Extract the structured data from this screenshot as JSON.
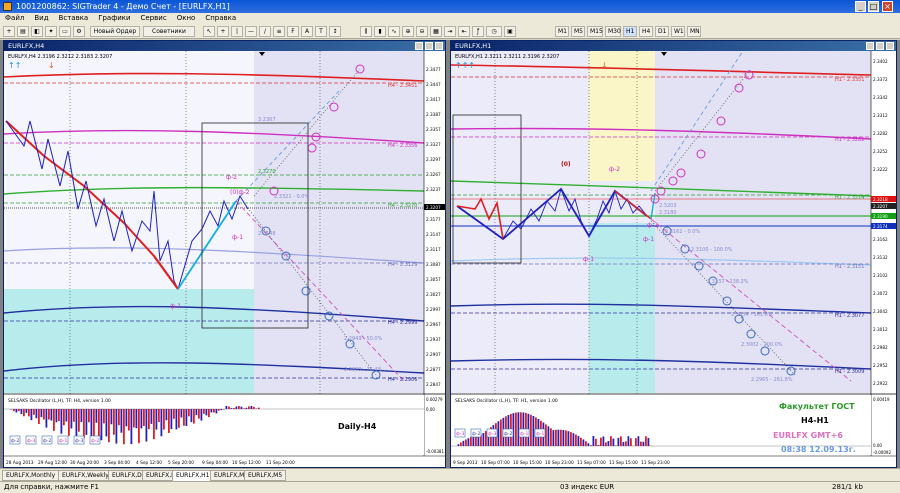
{
  "app": {
    "title": "1001200862: SIGTrader 4 - Демо Счет - [EURLFX,H1]"
  },
  "menu": [
    "Файл",
    "Вид",
    "Вставка",
    "Графики",
    "Сервис",
    "Окно",
    "Справка"
  ],
  "toolbar": {
    "new_order": "Новый Ордер",
    "advisors": "Советники",
    "timeframes": [
      "M1",
      "M5",
      "M15",
      "M30",
      "H1",
      "H4",
      "D1",
      "W1",
      "MN"
    ]
  },
  "left_window": {
    "title": "EURLFX,H4",
    "info": "EURLFX,H4  2.3196 2.3212 2.3183 2.3207",
    "price_ticks": [
      "2.3477",
      "2.3447",
      "2.3417",
      "2.3387",
      "2.3357",
      "2.3327",
      "2.3297",
      "2.3267",
      "2.3237",
      "2.3207",
      "2.3177",
      "2.3147",
      "2.3117",
      "2.3087",
      "2.3057",
      "2.3027",
      "2.2997",
      "2.2967",
      "2.2937",
      "2.2907",
      "2.2877",
      "2.2847"
    ],
    "levels": [
      {
        "label": "H4 - 2.3451",
        "color": "#e03030"
      },
      {
        "label": "H4 - 2.3356",
        "color": "#d030c0"
      },
      {
        "label": "H4 - 2.3270",
        "color": "#30a030"
      },
      {
        "label": "H4 - 2.3129",
        "color": "#7070c0"
      },
      {
        "label": "H4 - 2.2999",
        "color": "#3030a0"
      },
      {
        "label": "H4 - 2.2906",
        "color": "#3030a0"
      }
    ],
    "fibs": [
      "3.2367",
      "2.3321 - 0.0%",
      "2.3270",
      "2.3148",
      "2.2949 - 50.0%",
      "2.2883 - 76.4%"
    ],
    "markers": [
      "ф-2",
      "(0)ф-2",
      "ф-1",
      "ф-1"
    ],
    "dates": [
      "28 Aug 2013",
      "29 Aug 12:00",
      "30 Aug 20:00",
      "3 Sep 04:00",
      "4 Sep 12:00",
      "5 Sep 20:00",
      "9 Sep 04:00",
      "10 Sep 12:00",
      "11 Sep 20:00"
    ],
    "osc_label": "SELSAKS Oscillator (L,H), TF: H4, version 1.00",
    "osc_ticks": [
      "0.00279",
      "0.00",
      "-0.00381"
    ],
    "boxes": [
      "ф-2",
      "ф-3",
      "ф-2",
      "ф-1",
      "ф-3",
      "ф-2"
    ],
    "caption": "Daily-H4"
  },
  "right_window": {
    "title": "EURLFX,H1",
    "info": "EURLFX,H1  2.3211 2.3211 2.3196 2.3207",
    "price_ticks": [
      "2.3402",
      "2.3372",
      "2.3342",
      "2.3312",
      "2.3282",
      "2.3252",
      "2.3222",
      "2.3207",
      "2.3192",
      "2.3174",
      "2.3162",
      "2.3132",
      "2.3102",
      "2.3072",
      "2.3042",
      "2.3012",
      "2.2982",
      "2.2952",
      "2.2922",
      "2.2892",
      "2.2862"
    ],
    "price_tags": [
      {
        "text": "2.3218",
        "color": "#e01010"
      },
      {
        "text": "2.3207",
        "color": "#222"
      },
      {
        "text": "2.3190",
        "color": "#10a010"
      },
      {
        "text": "2.3174",
        "color": "#1030c0"
      }
    ],
    "levels": [
      {
        "label": "H1 - 2.3351",
        "color": "#e03030"
      },
      {
        "label": "H1 - 2.3282",
        "color": "#d030c0"
      },
      {
        "label": "H1 - 2.3214",
        "color": "#30a030"
      },
      {
        "label": "H1 - 2.3151",
        "color": "#7070c0"
      },
      {
        "label": "H1 - 2.3077",
        "color": "#3030a0"
      },
      {
        "label": "H1 - 2.3009",
        "color": "#3030a0"
      }
    ],
    "fibs": [
      "2.3203",
      "2.3180",
      "2.3162 - 0.0%",
      "2.3100 - 100.0%",
      "2.3137 - 138.2%",
      "2.3034 - 161.8%",
      "2.3002 - 200.0%",
      "2.2965 - 261.8%"
    ],
    "markers": [
      "(0)",
      "ф-2",
      "ф-1",
      "ф-1",
      "ф-2"
    ],
    "dates": [
      "9 Sep 2013",
      "10 Sep 07:00",
      "10 Sep 15:00",
      "10 Sep 23:00",
      "11 Sep 07:00",
      "11 Sep 15:00",
      "11 Sep 23:00"
    ],
    "osc_label": "SELSAKS Oscillator (L,H), TF: H1, version 1.00",
    "osc_ticks": [
      "0.00419",
      "0.00",
      "-0.00092"
    ],
    "boxes": [
      "ф-3",
      "ф-2",
      "ф-3",
      "ф-2",
      "ф-1",
      "ф-1"
    ],
    "watermark": {
      "line1": "Факультет ГОСТ",
      "line2": "H4-H1",
      "line3": "EURLFX   GMT+6",
      "line4": "08:38   12.09.13г."
    }
  },
  "tabs": [
    "EURLFX,Monthly",
    "EURLFX,Weekly",
    "EURLFX,Daily",
    "EURLFX,H4",
    "EURLFX,H1",
    "EURLFX,M15",
    "EURLFX,M5"
  ],
  "active_tab": "EURLFX,H1",
  "status": {
    "help": "Для справки, нажмите F1",
    "profile": "03 индекс EUR",
    "connection": "281/1 kb"
  }
}
